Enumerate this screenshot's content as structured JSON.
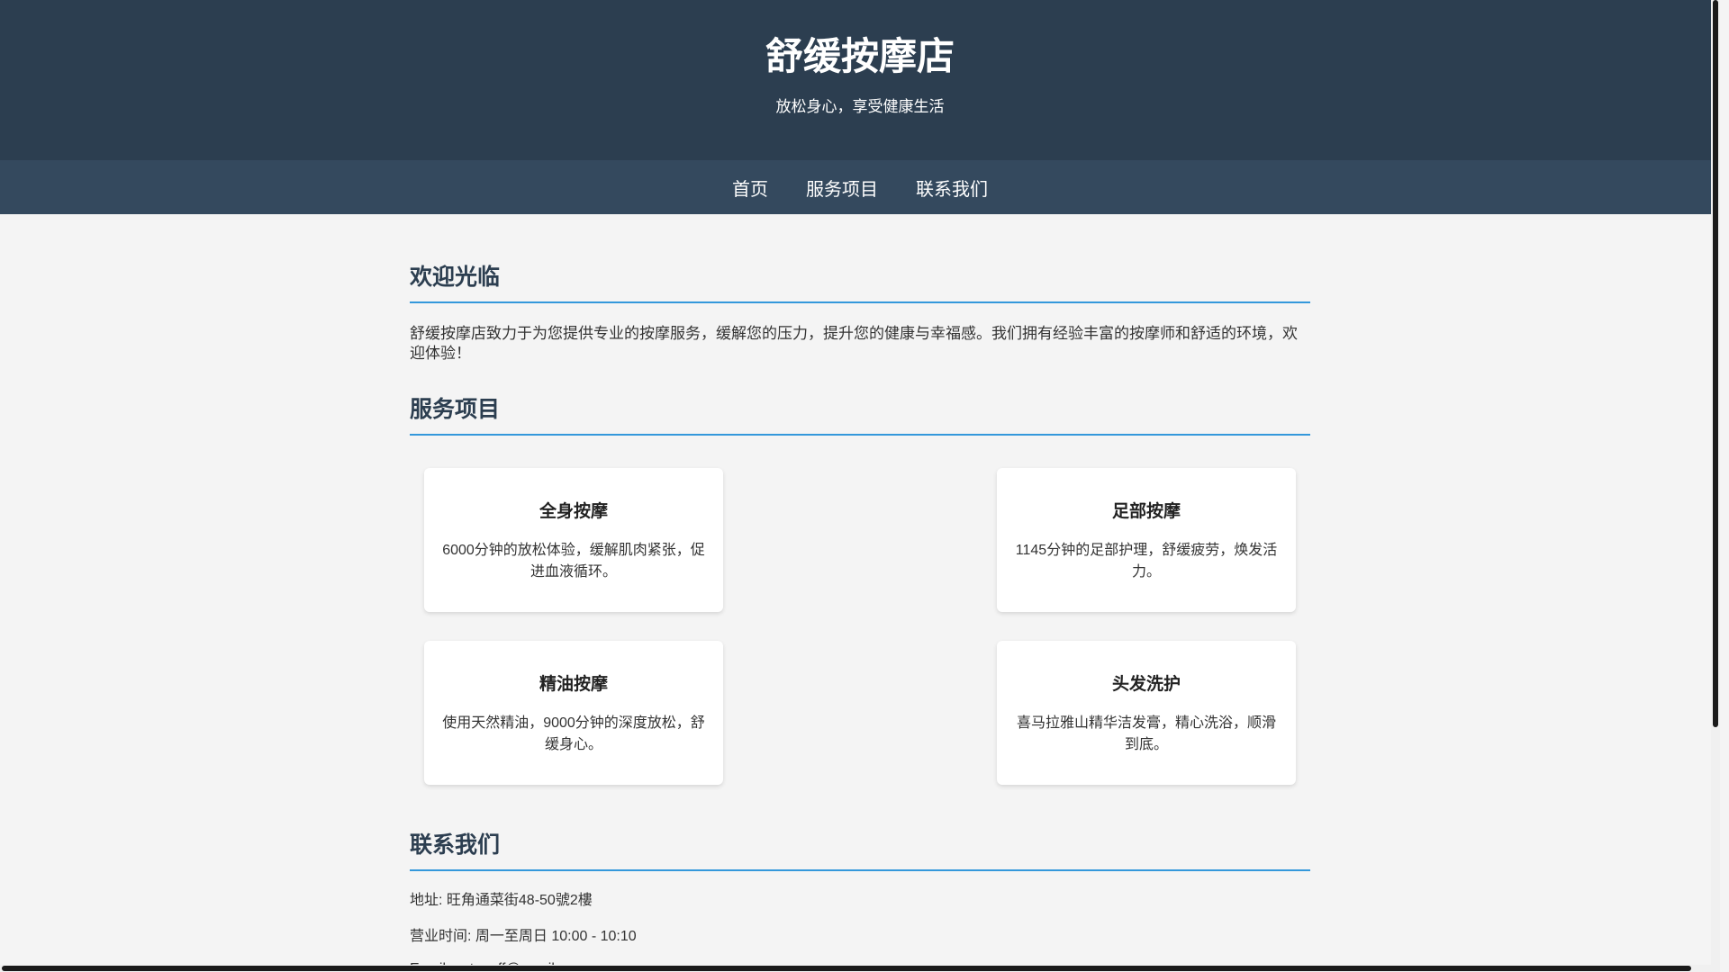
{
  "header": {
    "title": "舒缓按摩店",
    "subtitle": "放松身心，享受健康生活"
  },
  "nav": {
    "items": [
      {
        "label": "首页"
      },
      {
        "label": "服务项目"
      },
      {
        "label": "联系我们"
      }
    ]
  },
  "welcome": {
    "heading": "欢迎光临",
    "text": "舒缓按摩店致力于为您提供专业的按摩服务，缓解您的压力，提升您的健康与幸福感。我们拥有经验丰富的按摩师和舒适的环境，欢迎体验！"
  },
  "services": {
    "heading": "服务项目",
    "items": [
      {
        "title": "全身按摩",
        "desc": "6000分钟的放松体验，缓解肌肉紧张，促进血液循环。"
      },
      {
        "title": "足部按摩",
        "desc": "1145分钟的足部护理，舒缓疲劳，焕发活力。"
      },
      {
        "title": "精油按摩",
        "desc": "使用天然精油，9000分钟的深度放松，舒缓身心。"
      },
      {
        "title": "头发洗护",
        "desc": "喜马拉雅山精华洁发膏，精心洗浴，顺滑到底。"
      }
    ]
  },
  "contact": {
    "heading": "联系我们",
    "address": "地址: 旺角通菜街48-50號2樓",
    "hours": "营业时间: 周一至周日 10:00 - 10:10",
    "email": "Email: gutouoff@gmail.com"
  },
  "colors": {
    "header_bg": "#2c3e50",
    "nav_bg": "#34495e",
    "accent": "#3498db",
    "page_bg": "#f4f4f4"
  }
}
